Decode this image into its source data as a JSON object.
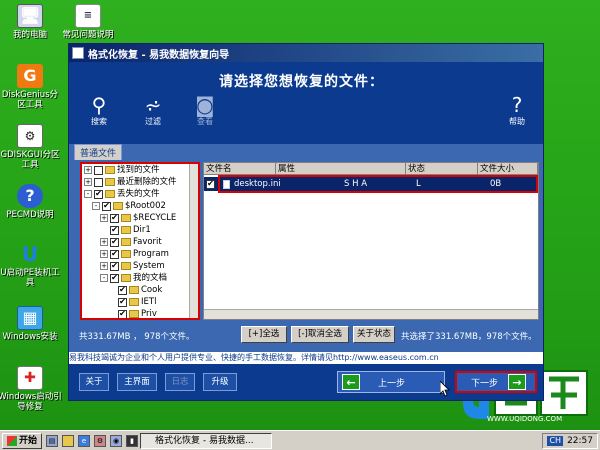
{
  "desktop": {
    "icons": [
      {
        "label": "我的电脑",
        "icon": "computer-icon"
      },
      {
        "label": "常见问题说明",
        "icon": "document-icon"
      },
      {
        "label": "DiskGenius分区工具",
        "icon": "diskgenius-icon"
      },
      {
        "label": "GDISKGUI分区工具",
        "icon": "gdisk-icon"
      },
      {
        "label": "PECMD说明",
        "icon": "help-icon"
      },
      {
        "label": "U启动PE装机工具",
        "icon": "installer-icon"
      },
      {
        "label": "Windows安装",
        "icon": "windows-setup-icon"
      },
      {
        "label": "Windows启动引导修复",
        "icon": "repair-icon"
      }
    ]
  },
  "window": {
    "title": "格式化恢复 - 易我数据恢复向导",
    "headline": "请选择您想恢复的文件：",
    "toolbar": [
      {
        "label": "搜索",
        "icon": "search-icon"
      },
      {
        "label": "过滤",
        "icon": "filter-icon"
      },
      {
        "label": "查看",
        "icon": "preview-icon"
      },
      {
        "label": "帮助",
        "icon": "help-icon"
      }
    ],
    "tab": "普通文件",
    "tree": [
      {
        "label": "找到的文件",
        "checked": false,
        "expander": "+"
      },
      {
        "label": "最近删除的文件",
        "checked": false,
        "expander": "+"
      },
      {
        "label": "丢失的文件",
        "checked": true,
        "expander": "-"
      },
      {
        "label": "$Root002",
        "checked": true,
        "expander": "-"
      },
      {
        "label": "$RECYCLE",
        "checked": true,
        "expander": "+"
      },
      {
        "label": "Dir1",
        "checked": true,
        "expander": ""
      },
      {
        "label": "Favorit",
        "checked": true,
        "expander": "+"
      },
      {
        "label": "Program",
        "checked": true,
        "expander": "+"
      },
      {
        "label": "System",
        "checked": true,
        "expander": "+"
      },
      {
        "label": "我的文档",
        "checked": true,
        "expander": "-"
      },
      {
        "label": "Cook",
        "checked": true,
        "expander": ""
      },
      {
        "label": "IETl",
        "checked": true,
        "expander": ""
      },
      {
        "label": "Priv",
        "checked": true,
        "expander": ""
      }
    ],
    "file_columns": [
      "文件名",
      "属性",
      "状态",
      "文件大小"
    ],
    "files": [
      {
        "name": "desktop.ini",
        "attr": "S H A",
        "status": "L",
        "size": "0B",
        "checked": true
      }
    ],
    "tree_summary": "共331.67MB ， 978个文件。",
    "select_all": "[+]全选",
    "deselect_all": "[-]取消全选",
    "about_status": "关于状态",
    "selected_summary": "共选择了331.67MB，978个文件。",
    "marquee": "易我科技竭诚为企业和个人用户提供专业、快捷的手工数据恢复。详情请见http://www.easeus.com.cn",
    "buttons": {
      "about": "关于",
      "main": "主界面",
      "log": "日志",
      "upgrade": "升级",
      "prev": "上一步",
      "next": "下一步"
    }
  },
  "brand": {
    "name": "U启动",
    "url": "WWW.UQIDONG.COM"
  },
  "taskbar": {
    "start": "开始",
    "task": "格式化恢复 - 易我数据...",
    "lang": "CH",
    "time": "22:57"
  }
}
